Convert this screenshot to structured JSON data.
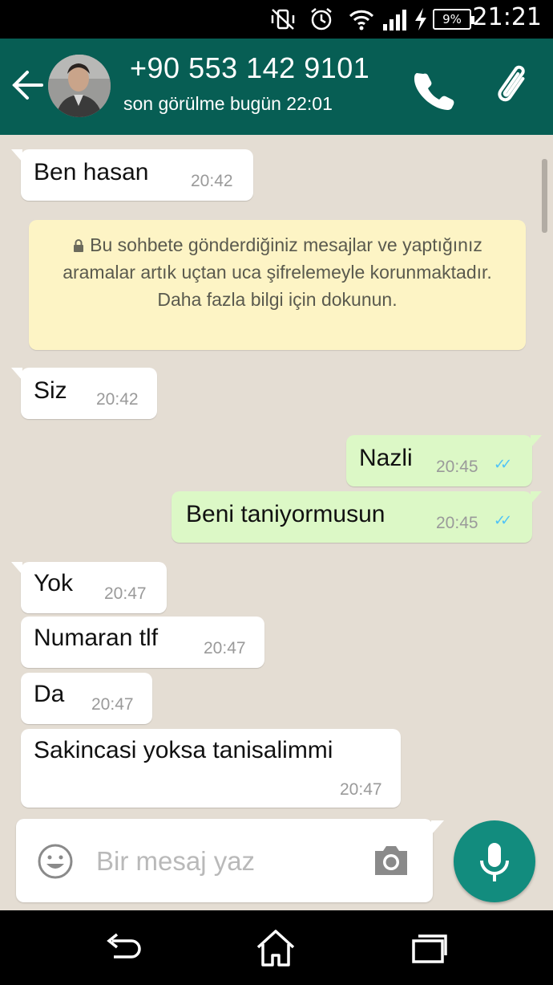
{
  "status_bar": {
    "time": "21:21",
    "battery": "9%",
    "icons": [
      "vibrate-off-icon",
      "alarm-icon",
      "wifi-icon",
      "signal-icon",
      "charging-icon",
      "battery-icon"
    ]
  },
  "header": {
    "contact_name": "+90 553 142 9101",
    "last_seen": "son görülme bugün 22:01",
    "icons": [
      "back-arrow-icon",
      "phone-icon",
      "paperclip-icon"
    ],
    "color": "#075e54"
  },
  "chat": {
    "background_color": "#e4ddd3",
    "messages": [
      {
        "direction": "in",
        "text": "Ben hasan",
        "time": "20:42"
      },
      {
        "direction": "in",
        "text": "Siz",
        "time": "20:42"
      },
      {
        "direction": "out",
        "text": "Nazli",
        "time": "20:45",
        "status": "read"
      },
      {
        "direction": "out",
        "text": "Beni taniyormusun",
        "time": "20:45",
        "status": "read"
      },
      {
        "direction": "in",
        "text": "Yok",
        "time": "20:47"
      },
      {
        "direction": "in",
        "text": "Numaran tlf",
        "time": "20:47"
      },
      {
        "direction": "in",
        "text": "Da",
        "time": "20:47"
      },
      {
        "direction": "in",
        "text": "Sakincasi yoksa tanisalimmi",
        "time": "20:47"
      }
    ],
    "encryption_notice": "Bu sohbete gönderdiğiniz mesajlar ve yaptığınız aramalar artık uçtan uca şifrelemeyle korunmaktadır. Daha fazla bilgi için dokunun.",
    "outgoing_bubble_color": "#dcf8c6",
    "notice_color": "#fdf4c5",
    "read_tick_color": "#4fc3f7"
  },
  "composer": {
    "placeholder": "Bir mesaj yaz",
    "value": "",
    "icons": [
      "emoji-icon",
      "camera-icon",
      "microphone-icon"
    ],
    "mic_button_color": "#128c7e"
  },
  "nav_bar": {
    "icons": [
      "back-nav-icon",
      "home-icon",
      "recent-apps-icon"
    ]
  }
}
